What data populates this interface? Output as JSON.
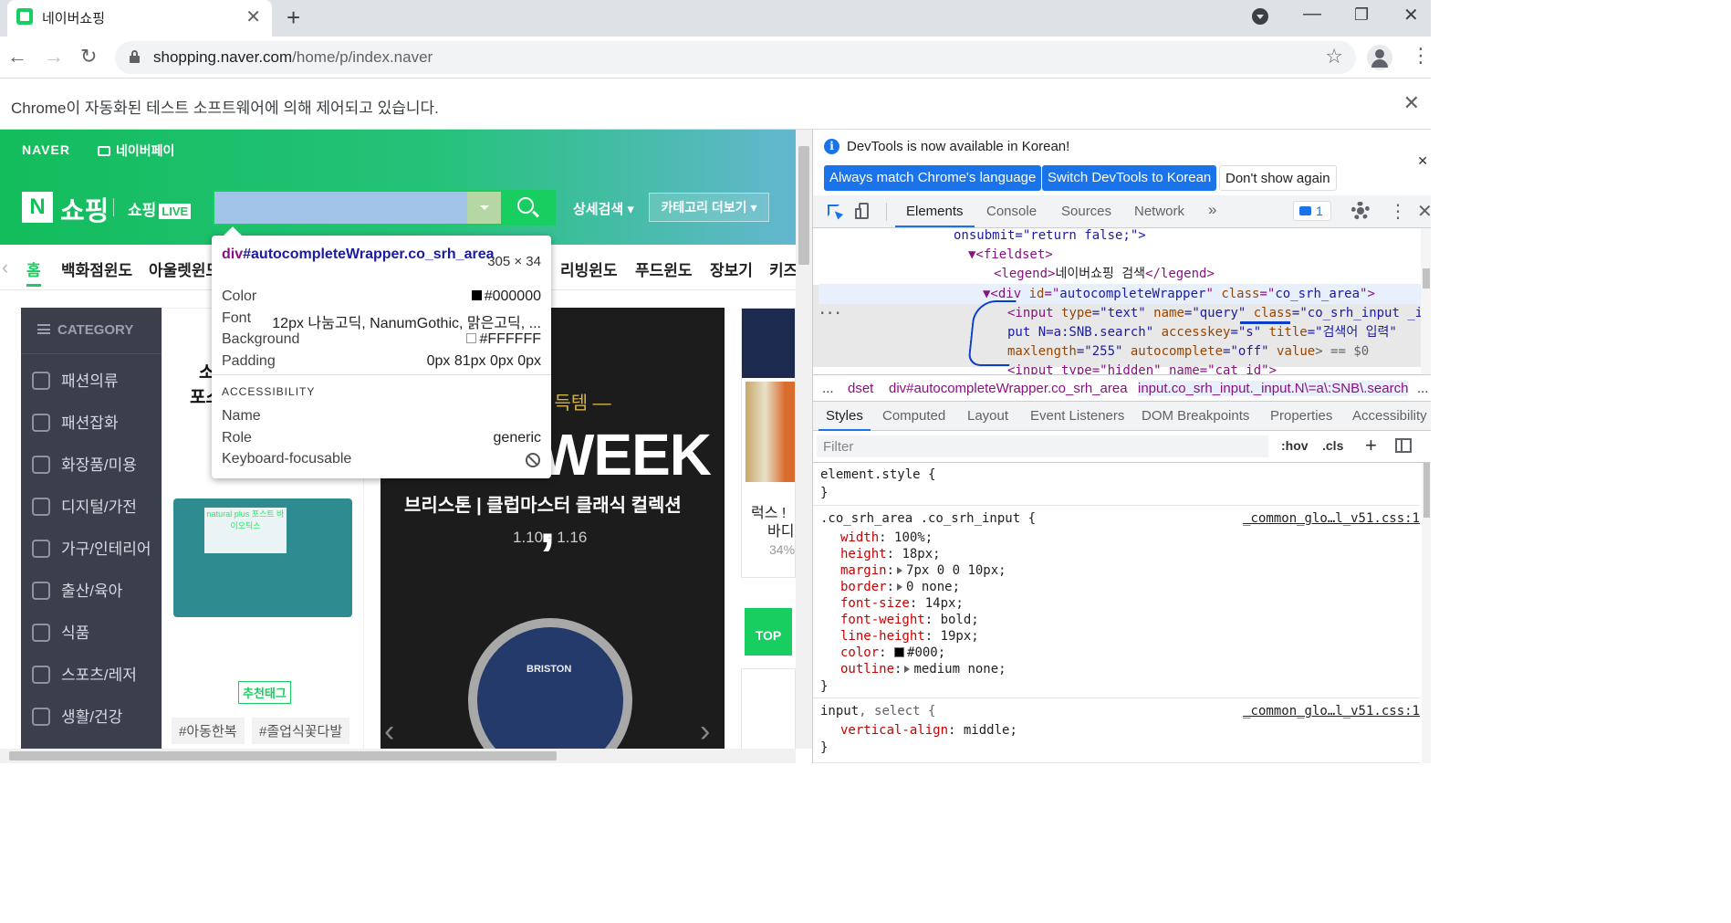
{
  "browser": {
    "tab_title": "네이버쇼핑",
    "url_host": "shopping.naver.com",
    "url_path": "/home/p/index.naver",
    "automation_notice": "Chrome이 자동화된 테스트 소프트웨어에 의해 제어되고 있습니다."
  },
  "site": {
    "naver_logo": "NAVER",
    "npay": "네이버페이",
    "n_box": "N",
    "shopping_word": "쇼핑",
    "shopping_live": "쇼핑",
    "live_badge": "LIVE",
    "detail_search": "상세검색 ▾",
    "category_more": "카테고리 더보기 ▾",
    "menu": [
      "홈",
      "백화점윈도",
      "아울렛윈도",
      "리빙윈도",
      "푸드윈도",
      "장보기",
      "키즈"
    ],
    "category_header": "CATEGORY",
    "categories": [
      "패션의류",
      "패션잡화",
      "화장품/미용",
      "디지털/가전",
      "가구/인테리어",
      "출산/육아",
      "식품",
      "스포츠/레저",
      "생활/건강"
    ],
    "promo_title_a": "소",
    "promo_title_b": "포스",
    "product_label": "natural plus 포스트 바이오틱스",
    "recommend_tag": "추천태그",
    "tags": [
      "#아동한복",
      "#졸업식꽃다발"
    ],
    "banner_line1": "의 신상 득템 —",
    "banner_big": "WEEK ,",
    "banner_line2": "브리스톤 | 클럽마스터 클래식 컬렉션",
    "banner_dates": "1.10 - 1.16",
    "watch_brand": "BRISTON",
    "prev_arrow": "‹",
    "next_arrow": "›",
    "right_text1": "럭스 !",
    "right_text2": "바디",
    "right_text3": "34%",
    "top_button": "TOP"
  },
  "tooltip": {
    "selector_tag": "div",
    "selector_rest": "#autocompleteWrapper.co_srh_area",
    "size": "305 × 34",
    "rows": [
      {
        "label": "Color",
        "value": "#000000",
        "swatch": "#000000"
      },
      {
        "label": "Font",
        "value": "12px 나눔고딕, NanumGothic, 맑은고딕, ..."
      },
      {
        "label": "Background",
        "value": "#FFFFFF",
        "swatch": "#FFFFFF"
      },
      {
        "label": "Padding",
        "value": "0px 81px 0px 0px"
      }
    ],
    "accessibility_header": "ACCESSIBILITY",
    "acc_rows": [
      {
        "label": "Name",
        "value": ""
      },
      {
        "label": "Role",
        "value": "generic"
      },
      {
        "label": "Keyboard-focusable",
        "value": ""
      }
    ]
  },
  "devtools": {
    "info_text": "DevTools is now available in Korean!",
    "btn_match": "Always match Chrome's language",
    "btn_switch": "Switch DevTools to Korean",
    "btn_dont": "Don't show again",
    "tabs": [
      "Elements",
      "Console",
      "Sources",
      "Network",
      "»"
    ],
    "issues_count": "1",
    "dom": {
      "l1": "onsubmit=\"return false;\">",
      "l2": "▼<fieldset>",
      "l3a": "<legend>",
      "l3b": "네이버쇼핑 검색",
      "l3c": "</legend>",
      "l4a": "▼<div ",
      "l4b": "id",
      "l4c": "=\"",
      "l4d": "autocompleteWrapper",
      "l4e": "\" ",
      "l4f": "class",
      "l4g": "=\"",
      "l4h": "co_srh_area",
      "l4i": "\">",
      "dots": "...",
      "l5a": "<input ",
      "l5b": "type",
      "l5c": "=\"text\" ",
      "l5d": "name",
      "l5e": "=\"query\" ",
      "l5f": "class",
      "l5g": "=\"co_srh_input _in",
      "l6a": "put N=a:SNB.search\" ",
      "l6b": "accesskey",
      "l6c": "=\"s\" ",
      "l6d": "title",
      "l6e": "=\"검색어 입력\"",
      "l7a": "maxlength",
      "l7b": "=\"255\" ",
      "l7c": "autocomplete",
      "l7d": "=\"off\" ",
      "l7e": "value",
      "l7f": "> == $0",
      "l8": "<input type=\"hidden\" name=\"cat_id\">"
    },
    "crumbs": [
      "...",
      "dset",
      "div#autocompleteWrapper.co_srh_area",
      "input.co_srh_input._input.N\\=a\\:SNB\\.search",
      "..."
    ],
    "style_tabs": [
      "Styles",
      "Computed",
      "Layout",
      "Event Listeners",
      "DOM Breakpoints",
      "Properties",
      "Accessibility"
    ],
    "filter_placeholder": "Filter",
    "hov": ":hov",
    "cls": ".cls",
    "plus": "+",
    "rules": {
      "element_style": "element.style {",
      "close": "}",
      "r2_selector": ".co_srh_area .co_srh_input {",
      "r2_source": "_common_glo…l_v51.css:1",
      "r2_props": [
        {
          "name": "width",
          "value": "100%;"
        },
        {
          "name": "height",
          "value": "18px;"
        },
        {
          "name": "margin",
          "value": "7px 0 0 10px;",
          "expand": true
        },
        {
          "name": "border",
          "value": "0 none;",
          "expand": true
        },
        {
          "name": "font-size",
          "value": "14px;"
        },
        {
          "name": "font-weight",
          "value": "bold;"
        },
        {
          "name": "line-height",
          "value": "19px;"
        },
        {
          "name": "color",
          "value": "#000;",
          "swatch": true
        },
        {
          "name": "outline",
          "value": "medium none;",
          "expand": true
        }
      ],
      "r3_selector_a": "input",
      "r3_selector_b": ", select {",
      "r3_source": "_common_glo…l_v51.css:1",
      "r3_prop_name": "vertical-align",
      "r3_prop_value": "middle;"
    }
  }
}
